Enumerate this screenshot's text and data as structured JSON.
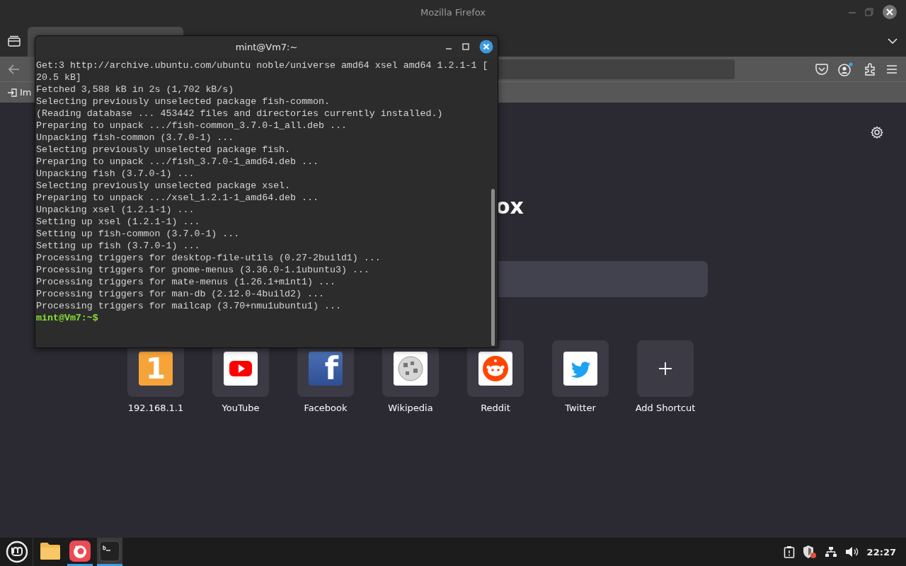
{
  "firefox": {
    "title": "Mozilla Firefox",
    "bookmarks": [
      {
        "label": "Im"
      }
    ],
    "brand_fragment": "ox",
    "shortcuts": [
      {
        "label": "192.168.1.1",
        "kind": "digit",
        "icon_text": "1"
      },
      {
        "label": "YouTube",
        "kind": "video"
      },
      {
        "label": "Facebook",
        "kind": "letter",
        "icon_text": "f"
      },
      {
        "label": "Wikipedia",
        "kind": "globe"
      },
      {
        "label": "Reddit",
        "kind": "alien"
      },
      {
        "label": "Twitter",
        "kind": "bird"
      },
      {
        "label": "Add Shortcut",
        "kind": "add"
      }
    ]
  },
  "terminal": {
    "title": "mint@Vm7:~",
    "lines": [
      {
        "kind": "output",
        "text": "Get:3 http://archive.ubuntu.com/ubuntu noble/universe amd64 xsel amd64 1.2.1-1 ["
      },
      {
        "kind": "output",
        "text": "20.5 kB]"
      },
      {
        "kind": "output",
        "text": "Fetched 3,588 kB in 2s (1,702 kB/s)"
      },
      {
        "kind": "output",
        "text": "Selecting previously unselected package fish-common."
      },
      {
        "kind": "output",
        "text": "(Reading database ... 453442 files and directories currently installed.)"
      },
      {
        "kind": "output",
        "text": "Preparing to unpack .../fish-common_3.7.0-1_all.deb ..."
      },
      {
        "kind": "output",
        "text": "Unpacking fish-common (3.7.0-1) ..."
      },
      {
        "kind": "output",
        "text": "Selecting previously unselected package fish."
      },
      {
        "kind": "output",
        "text": "Preparing to unpack .../fish_3.7.0-1_amd64.deb ..."
      },
      {
        "kind": "output",
        "text": "Unpacking fish (3.7.0-1) ..."
      },
      {
        "kind": "output",
        "text": "Selecting previously unselected package xsel."
      },
      {
        "kind": "output",
        "text": "Preparing to unpack .../xsel_1.2.1-1_amd64.deb ..."
      },
      {
        "kind": "output",
        "text": "Unpacking xsel (1.2.1-1) ..."
      },
      {
        "kind": "output",
        "text": "Setting up xsel (1.2.1-1) ..."
      },
      {
        "kind": "output",
        "text": "Setting up fish-common (3.7.0-1) ..."
      },
      {
        "kind": "output",
        "text": "Setting up fish (3.7.0-1) ..."
      },
      {
        "kind": "output",
        "text": "Processing triggers for desktop-file-utils (0.27-2build1) ..."
      },
      {
        "kind": "output",
        "text": "Processing triggers for gnome-menus (3.36.0-1.1ubuntu3) ..."
      },
      {
        "kind": "output",
        "text": "Processing triggers for mate-menus (1.26.1+mint1) ..."
      },
      {
        "kind": "output",
        "text": "Processing triggers for man-db (2.12.0-4build2) ..."
      },
      {
        "kind": "output",
        "text": "Processing triggers for mailcap (3.70+nmu1ubuntu1) ..."
      },
      {
        "kind": "prompt",
        "text": "mint@Vm7:~$"
      }
    ]
  },
  "taskbar": {
    "apps": [
      {
        "kind": "files",
        "running": false,
        "selected": false
      },
      {
        "kind": "firefox",
        "running": true,
        "selected": false
      },
      {
        "kind": "terminal",
        "running": true,
        "selected": true
      }
    ],
    "clock": "22:27"
  }
}
